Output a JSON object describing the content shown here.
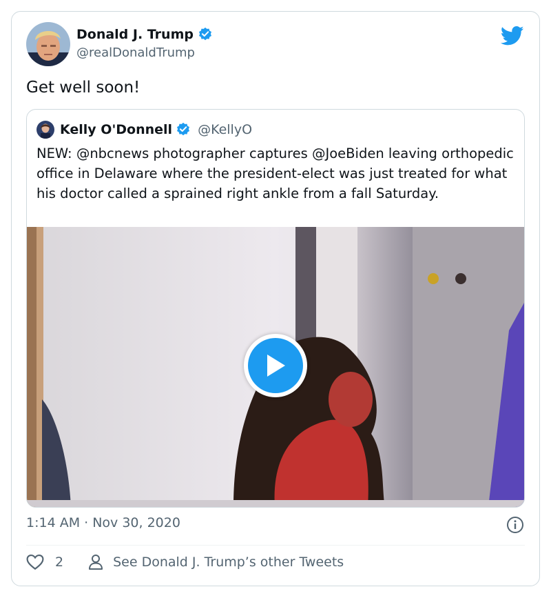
{
  "tweet": {
    "author_name": "Donald J. Trump",
    "author_handle": "@realDonaldTrump",
    "text": "Get well soon!",
    "timestamp": "1:14 AM · Nov 30, 2020",
    "like_count": "2",
    "see_more_label": "See Donald J. Trump’s other Tweets"
  },
  "quoted": {
    "author_name": "Kelly O'Donnell",
    "author_handle": "@KellyO",
    "text": "NEW:  @nbcnews photographer captures @JoeBiden leaving orthopedic office in Delaware where the president-elect was just treated for what his doctor called a sprained right ankle from a fall Saturday."
  },
  "icons": {
    "verified": "verified-badge-icon",
    "brand": "twitter-bird-icon",
    "play": "play-icon",
    "info": "info-icon",
    "like": "heart-icon",
    "profile": "person-icon"
  },
  "colors": {
    "accent": "#1d9bf0",
    "text_primary": "#0f1419",
    "text_secondary": "#536471",
    "border": "#cfd9de"
  }
}
